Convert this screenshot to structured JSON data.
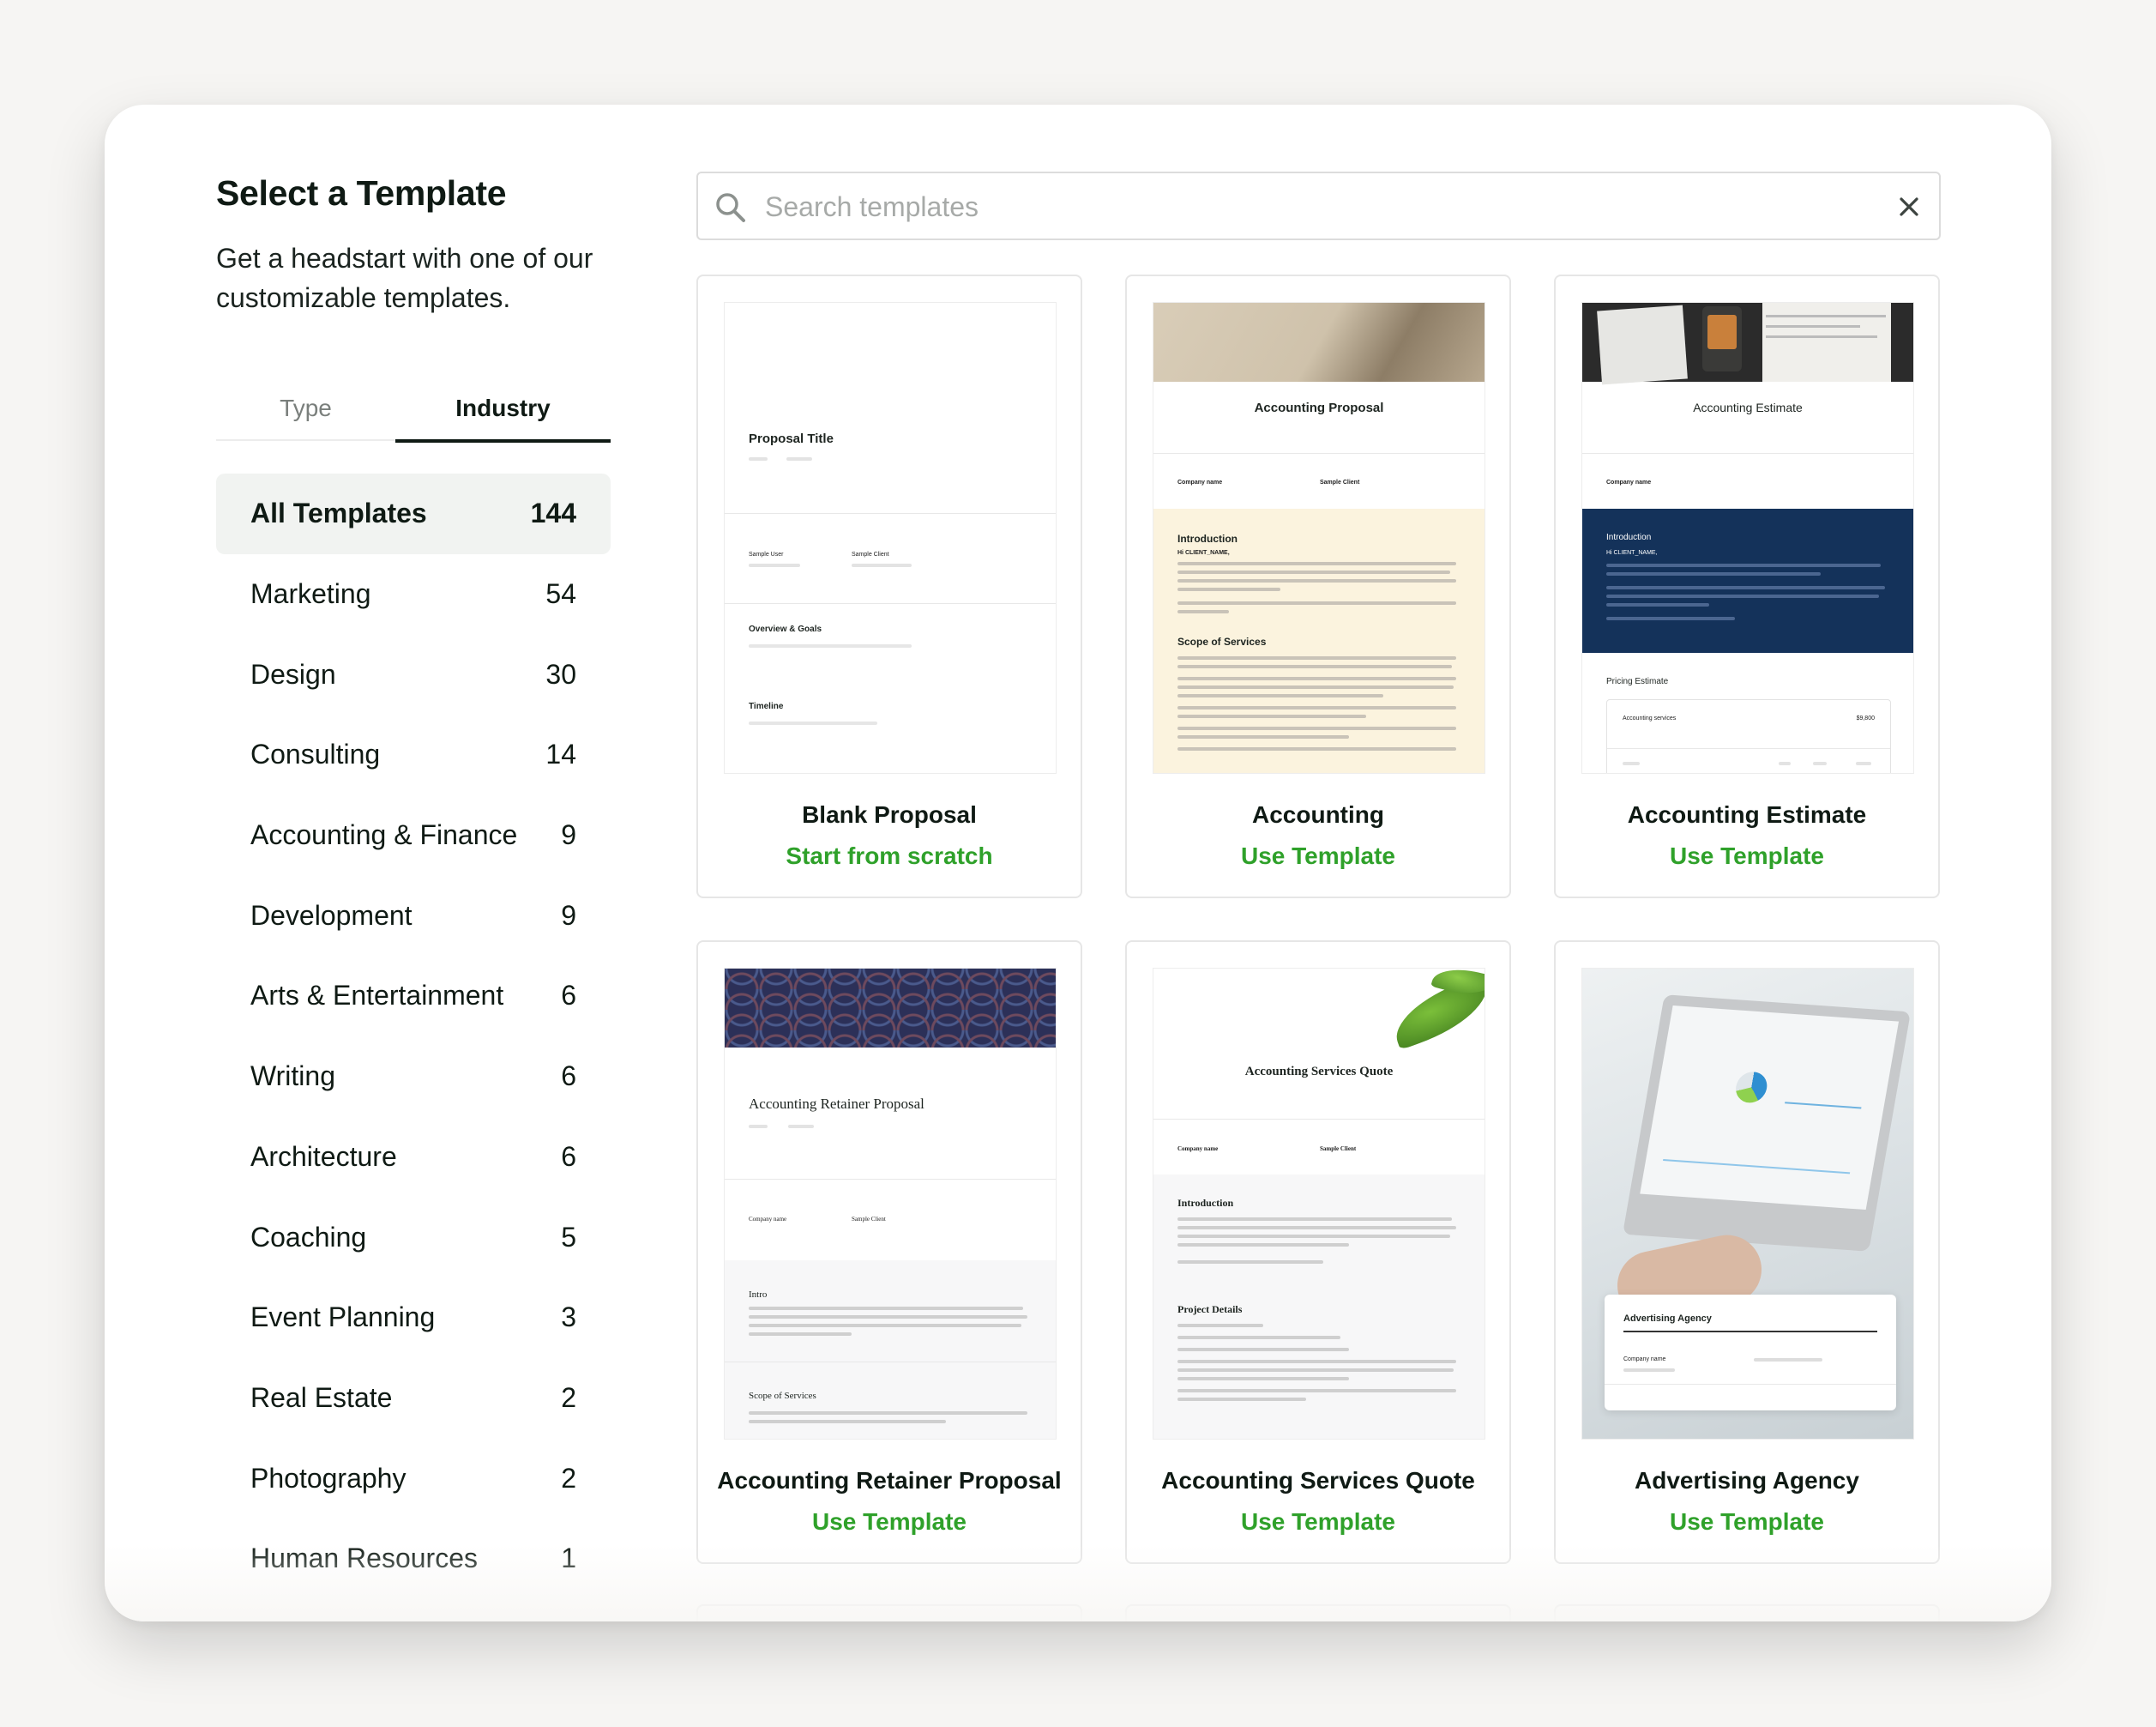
{
  "sidebar": {
    "title": "Select a Template",
    "subtitle": "Get a headstart with one of our customizable templates.",
    "tabs": [
      {
        "label": "Type",
        "active": false
      },
      {
        "label": "Industry",
        "active": true
      }
    ],
    "categories": [
      {
        "label": "All Templates",
        "count": "144",
        "active": true
      },
      {
        "label": "Marketing",
        "count": "54"
      },
      {
        "label": "Design",
        "count": "30"
      },
      {
        "label": "Consulting",
        "count": "14"
      },
      {
        "label": "Accounting & Finance",
        "count": "9"
      },
      {
        "label": "Development",
        "count": "9"
      },
      {
        "label": "Arts & Entertainment",
        "count": "6"
      },
      {
        "label": "Writing",
        "count": "6"
      },
      {
        "label": "Architecture",
        "count": "6"
      },
      {
        "label": "Coaching",
        "count": "5"
      },
      {
        "label": "Event Planning",
        "count": "3"
      },
      {
        "label": "Real Estate",
        "count": "2"
      },
      {
        "label": "Photography",
        "count": "2"
      },
      {
        "label": "Human Resources",
        "count": "1"
      }
    ]
  },
  "search": {
    "placeholder": "Search templates",
    "value": ""
  },
  "colors": {
    "accent_green": "#2fa12a",
    "text": "#0f1a14",
    "navy": "#14325a",
    "cream": "#fbf3de"
  },
  "templates": [
    {
      "name": "Blank Proposal",
      "action": "Start from scratch",
      "thumb": {
        "title": "Proposal Title",
        "sections": [
          "Overview & Goals",
          "Timeline"
        ],
        "from": "Sample User",
        "to": "Sample Client"
      }
    },
    {
      "name": "Accounting",
      "action": "Use Template",
      "thumb": {
        "title": "Accounting Proposal",
        "from": "Company name",
        "to": "Sample Client",
        "sections": [
          "Introduction",
          "Scope of Services"
        ],
        "greeting": "Hi CLIENT_NAME,"
      }
    },
    {
      "name": "Accounting Estimate",
      "action": "Use Template",
      "thumb": {
        "title": "Accounting Estimate",
        "from": "Company name",
        "sections": [
          "Introduction",
          "Pricing Estimate"
        ],
        "greeting": "Hi CLIENT_NAME,",
        "line_item": "Accounting services",
        "price": "$9,800"
      }
    },
    {
      "name": "Accounting Retainer Proposal",
      "action": "Use Template",
      "thumb": {
        "title": "Accounting Retainer Proposal",
        "from": "Company name",
        "to": "Sample Client",
        "sections": [
          "Intro",
          "Scope of Services"
        ]
      }
    },
    {
      "name": "Accounting Services Quote",
      "action": "Use Template",
      "thumb": {
        "title": "Accounting Services Quote",
        "from": "Company name",
        "to": "Sample Client",
        "sections": [
          "Introduction",
          "Project Details"
        ]
      }
    },
    {
      "name": "Advertising Agency",
      "action": "Use Template",
      "thumb": {
        "title": "Advertising Agency",
        "from": "Company name"
      }
    }
  ]
}
